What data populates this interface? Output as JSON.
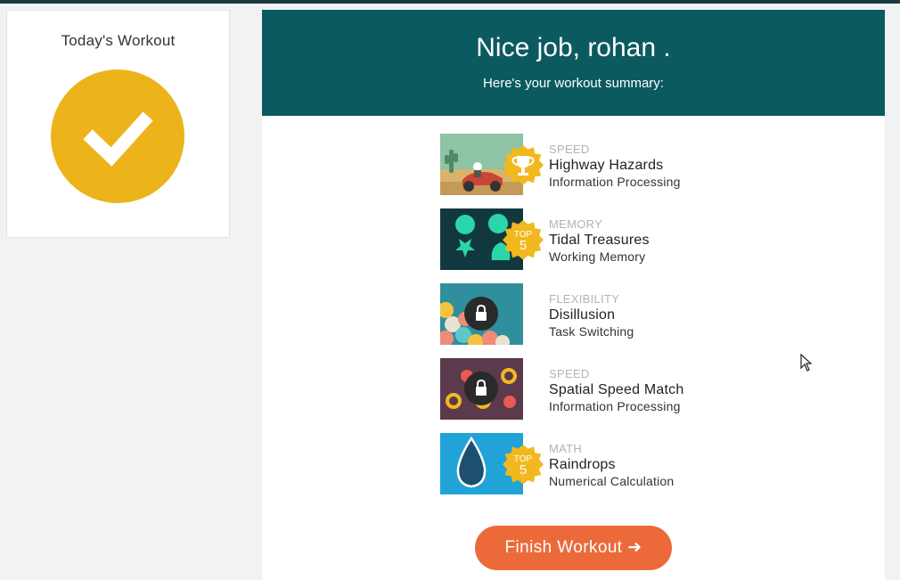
{
  "sidebar": {
    "title": "Today's Workout"
  },
  "header": {
    "title": "Nice job, rohan .",
    "subtitle": "Here's your workout summary:"
  },
  "games": [
    {
      "category": "SPEED",
      "name": "Highway Hazards",
      "skill": "Information Processing",
      "status": "trophy"
    },
    {
      "category": "MEMORY",
      "name": "Tidal Treasures",
      "skill": "Working Memory",
      "status": "top5",
      "badge_top": "TOP",
      "badge_num": "5"
    },
    {
      "category": "FLEXIBILITY",
      "name": "Disillusion",
      "skill": "Task Switching",
      "status": "locked"
    },
    {
      "category": "SPEED",
      "name": "Spatial Speed Match",
      "skill": "Information Processing",
      "status": "locked"
    },
    {
      "category": "MATH",
      "name": "Raindrops",
      "skill": "Numerical Calculation",
      "status": "top5",
      "badge_top": "TOP",
      "badge_num": "5"
    }
  ],
  "finish": {
    "label": "Finish Workout ➜"
  },
  "colors": {
    "header": "#0b5a5f",
    "check": "#ecb31b",
    "button": "#ec6a3a",
    "badge": "#f2b81f"
  }
}
